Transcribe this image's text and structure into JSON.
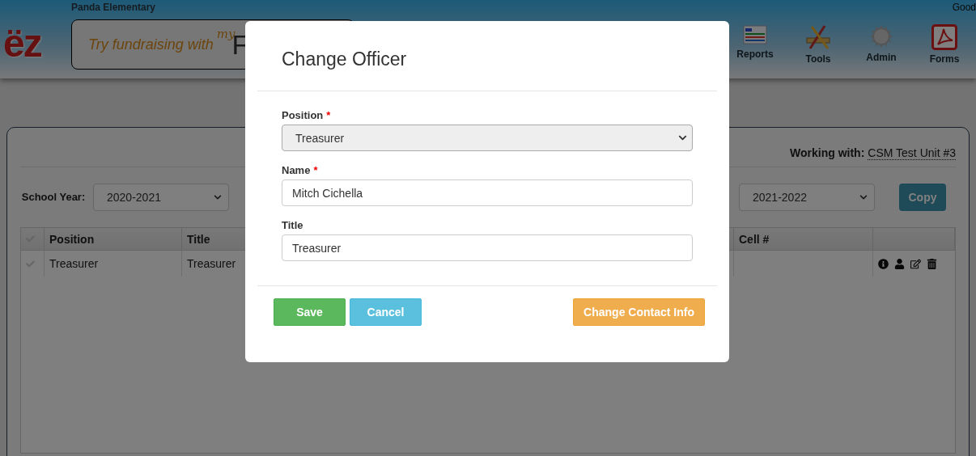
{
  "header": {
    "school": "Panda Elementary",
    "logo_text": "ëz",
    "banner": {
      "text": "Try fundraising with",
      "brand_small": "my",
      "brand_big": "F"
    },
    "greeting": "Good",
    "nav": [
      {
        "label": "Reports",
        "kind": "reports"
      },
      {
        "label": "Tools",
        "kind": "tools"
      },
      {
        "label": "Admin",
        "kind": "admin"
      },
      {
        "label": "Forms",
        "kind": "forms"
      }
    ]
  },
  "panel": {
    "working_with_label": "Working with:",
    "working_with_link": "CSM Test Unit #3",
    "school_year_label": "School Year:",
    "from_year": "2020-2021",
    "to_year": "2021-2022",
    "copy_button": "Copy",
    "table": {
      "columns": [
        "Position",
        "Title",
        "Cell #"
      ],
      "rows": [
        {
          "position": "Treasurer",
          "title": "Treasurer"
        }
      ]
    }
  },
  "modal": {
    "title": "Change Officer",
    "fields": [
      {
        "label": "Position",
        "required_mark": "*",
        "kind": "select",
        "value": "Treasurer"
      },
      {
        "label": "Name",
        "required_mark": "*",
        "kind": "input",
        "value": "Mitch Cichella"
      },
      {
        "label": "Title",
        "kind": "input",
        "value": "Treasurer"
      }
    ],
    "buttons": [
      {
        "label": "Save",
        "kind": "success"
      },
      {
        "label": "Cancel",
        "kind": "info"
      },
      {
        "label": "Change Contact Info",
        "kind": "warning"
      }
    ]
  }
}
